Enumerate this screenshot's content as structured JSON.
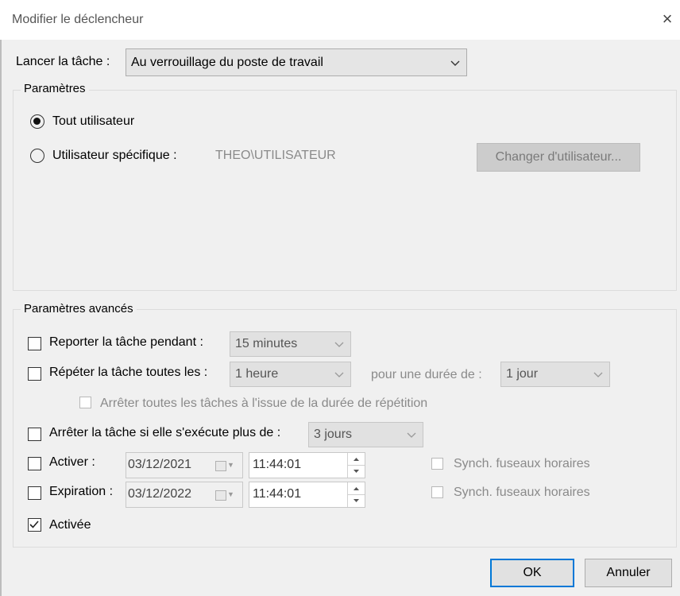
{
  "window": {
    "title": "Modifier le déclencheur",
    "close_label": "×"
  },
  "trigger": {
    "label": "Lancer la tâche :",
    "value": "Au verrouillage du poste de travail"
  },
  "settings": {
    "title": "Paramètres",
    "any_user_label": "Tout utilisateur",
    "specific_user_label": "Utilisateur spécifique :",
    "user_value": "THEO\\UTILISATEUR",
    "change_user_button": "Changer d'utilisateur..."
  },
  "advanced": {
    "title": "Paramètres avancés",
    "delay_label": "Reporter la tâche pendant :",
    "delay_value": "15 minutes",
    "repeat_label": "Répéter la tâche toutes les :",
    "repeat_value": "1 heure",
    "duration_label": "pour une durée de :",
    "duration_value": "1 jour",
    "stop_all_label": "Arrêter toutes les tâches à l'issue de la durée de répétition",
    "stop_if_label": "Arrêter la tâche si elle s'exécute plus de :",
    "stop_if_value": "3 jours",
    "activate_label": "Activer :",
    "activate_date": "03/12/2021",
    "activate_time": "11:44:01",
    "expire_label": "Expiration :",
    "expire_date": "03/12/2022",
    "expire_time": "11:44:01",
    "sync_label": "Synch. fuseaux horaires",
    "enabled_label": "Activée",
    "enabled_checked": true
  },
  "buttons": {
    "ok": "OK",
    "cancel": "Annuler"
  },
  "colors": {
    "accent": "#0078d7",
    "window_bg": "#f0f0f0"
  }
}
